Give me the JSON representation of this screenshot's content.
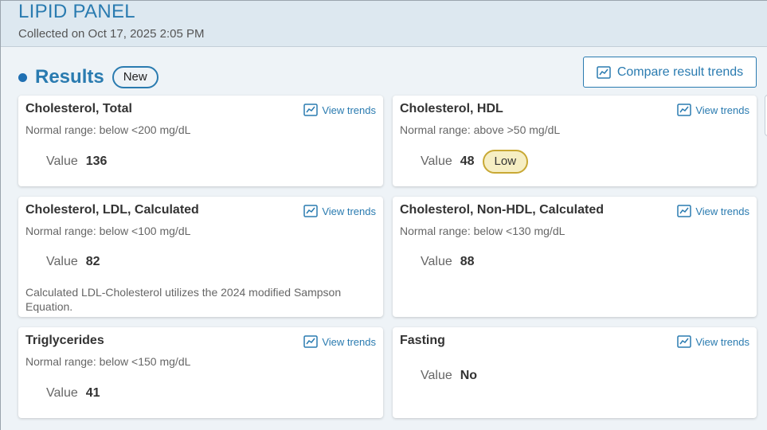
{
  "header": {
    "title": "LIPID PANEL",
    "collected": "Collected on Oct 17, 2025 2:05 PM"
  },
  "results": {
    "title": "Results",
    "badge": "New",
    "compare_label": "Compare result trends"
  },
  "trend_label": "View trends",
  "value_label": "Value",
  "colors": {
    "accent": "#2a7bb0",
    "flag_low_bg": "#f6eec3",
    "flag_low_border": "#c8a834"
  },
  "icons": {
    "trend": "line-chart-icon"
  },
  "cards": [
    {
      "name": "Cholesterol, Total",
      "range": "Normal range: below <200 mg/dL",
      "value": "136",
      "flag": ""
    },
    {
      "name": "Cholesterol, HDL",
      "range": "Normal range: above >50 mg/dL",
      "value": "48",
      "flag": "Low"
    },
    {
      "name": "Cholesterol, LDL, Calculated",
      "range": "Normal range: below <100 mg/dL",
      "value": "82",
      "flag": "",
      "note": "Calculated LDL-Cholesterol utilizes the 2024 modified Sampson Equation."
    },
    {
      "name": "Cholesterol, Non-HDL, Calculated",
      "range": "Normal range: below <130 mg/dL",
      "value": "88",
      "flag": ""
    },
    {
      "name": "Triglycerides",
      "range": "Normal range: below <150 mg/dL",
      "value": "41",
      "flag": ""
    },
    {
      "name": "Fasting",
      "range": "",
      "value": "No",
      "flag": ""
    }
  ]
}
